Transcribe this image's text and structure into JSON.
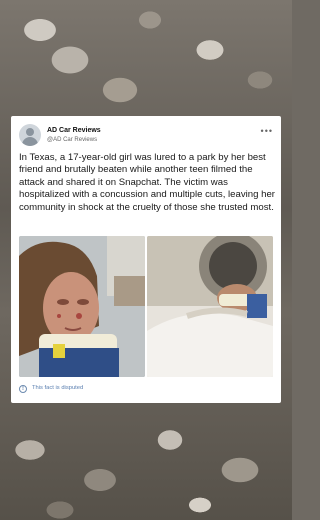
{
  "post": {
    "author_name": "AD Car Reviews",
    "author_handle": "@AD Car Reviews",
    "more_label": "•••",
    "text": "In Texas, a 17-year-old girl was lured to a park by her best friend and brutally beaten while another teen filmed the attack and shared it on Snapchat. The victim was hospitalized with a concussion and multiple cuts, leaving her community in shock at the cruelty of those she trusted most.",
    "disputed_label": "This fact is disputed"
  },
  "icons": {
    "avatar": "avatar-icon",
    "info": "info-icon"
  }
}
